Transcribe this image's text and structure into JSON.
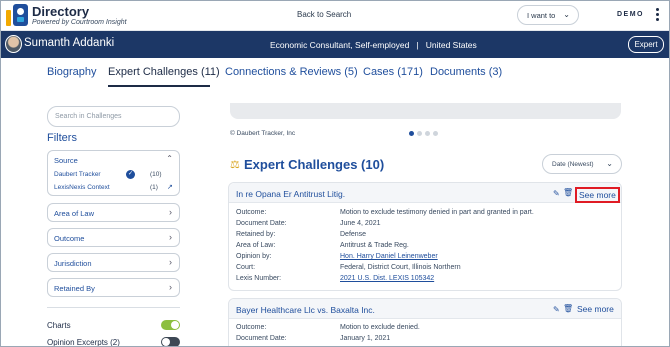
{
  "app": {
    "title": "Directory",
    "subtitle": "Powered by Courtroom Insight",
    "back_link": "Back to Search",
    "i_want_to": "I want to",
    "demo_label": "DEMO"
  },
  "profile": {
    "name": "Sumanth Addanki",
    "role": "Economic Consultant, Self-employed   |   United States",
    "badge": "Expert"
  },
  "tabs": [
    {
      "label": "Biography"
    },
    {
      "label": "Expert Challenges (11)"
    },
    {
      "label": "Connections & Reviews (5)"
    },
    {
      "label": "Cases (171)"
    },
    {
      "label": "Documents (3)"
    }
  ],
  "sidebar": {
    "search_placeholder": "Search in Challenges",
    "filters_heading": "Filters",
    "source": {
      "label": "Source",
      "items": [
        {
          "name": "Daubert Tracker",
          "count": "(10)"
        },
        {
          "name": "LexisNexis Context",
          "count": "(1)"
        }
      ]
    },
    "facets": [
      {
        "label": "Area of Law"
      },
      {
        "label": "Outcome"
      },
      {
        "label": "Jurisdiction"
      },
      {
        "label": "Retained By"
      }
    ],
    "toggles": [
      {
        "label": "Charts",
        "on": true
      },
      {
        "label": "Opinion Excerpts (2)",
        "on": false
      }
    ]
  },
  "main": {
    "carousel_credit": "© Daubert Tracker, Inc",
    "section_title": "Expert Challenges (10)",
    "sort_value": "Date (Newest)",
    "see_more": "See more",
    "cards": [
      {
        "title": "In re Opana Er Antitrust Litig.",
        "rows": [
          {
            "k": "Outcome:",
            "v": "Motion to exclude testimony denied in part and granted in part."
          },
          {
            "k": "Document Date:",
            "v": "June 4, 2021"
          },
          {
            "k": "Retained by:",
            "v": "Defense"
          },
          {
            "k": "Area of Law:",
            "v": "Antitrust & Trade Reg."
          },
          {
            "k": "Opinion by:",
            "v": "Hon. Harry Daniel Leinenweber"
          },
          {
            "k": "Court:",
            "v": "Federal, District Court, Illinois Northern"
          },
          {
            "k": "Lexis Number:",
            "v": "2021 U.S. Dist. LEXIS 105342"
          }
        ]
      },
      {
        "title": "Bayer Healthcare Llc vs. Baxalta Inc.",
        "rows": [
          {
            "k": "Outcome:",
            "v": "Motion to exclude denied."
          },
          {
            "k": "Document Date:",
            "v": "January 1, 2021"
          }
        ]
      }
    ]
  },
  "colors": {
    "navy": "#1c3766",
    "link_blue": "#1f4e9c",
    "toggle_on": "#8cbf3f",
    "highlight_red": "#e01b24",
    "accent_gold": "#f2a900"
  }
}
